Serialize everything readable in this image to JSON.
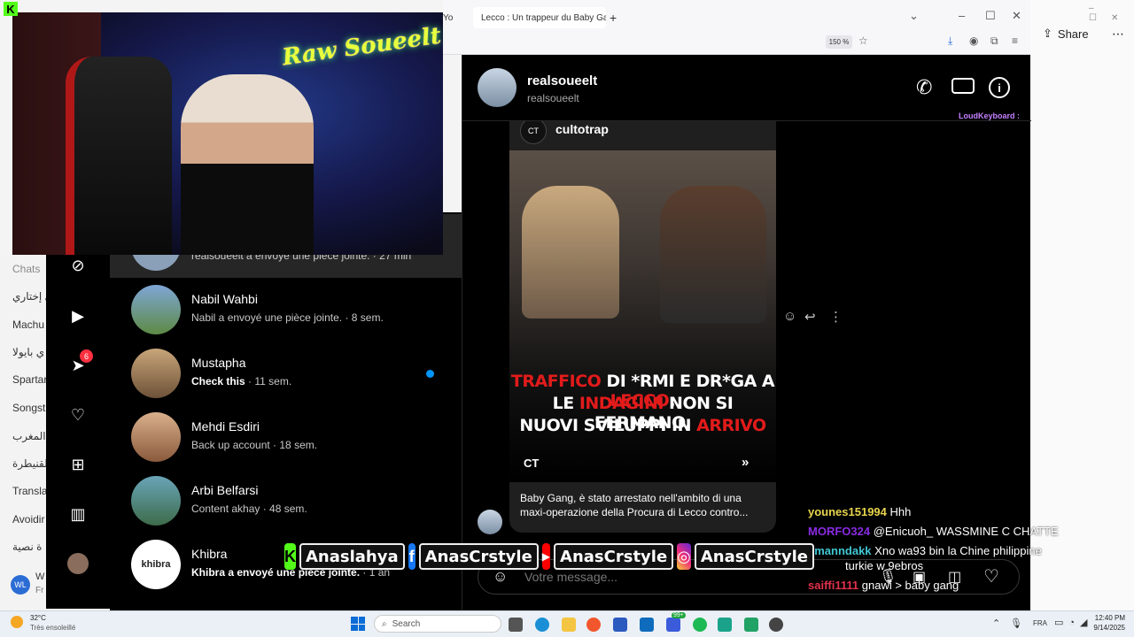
{
  "browser": {
    "tabs": [
      {
        "label": "Yo"
      },
      {
        "label": "Lecco : Un trappeur du Baby Ga"
      }
    ],
    "zoom": "150 %"
  },
  "outside": {
    "share": "Share"
  },
  "left_strip": {
    "header": "Chats",
    "items": [
      "يي إختاري",
      "Machu",
      "ي بايولا",
      "Spartar",
      "Songst",
      "المغرب",
      "لقنيطرة",
      "Translat",
      "Avoidir",
      "ة نصية"
    ],
    "avatar_initials": "WL",
    "extra": [
      "W",
      "Fr"
    ]
  },
  "instagram": {
    "rail_badges": {
      "notifications": "6"
    },
    "chats": [
      {
        "name": "",
        "preview": "realsoueelt a envoyé une pièce jointe. · 27 min"
      },
      {
        "name": "Nabil Wahbi",
        "preview": "Nabil a envoyé une pièce jointe. · 8 sem.",
        "bold": false
      },
      {
        "name": "Mustapha",
        "preview_bold": "Check this",
        "preview_rest": " · 11 sem."
      },
      {
        "name": "Mehdi Esdiri",
        "preview": "Back up account · 18 sem."
      },
      {
        "name": "Arbi Belfarsi",
        "preview": "Content akhay · 48 sem."
      },
      {
        "name": "Khibra",
        "preview_bold": "Khibra a envoyé une pièce jointe.",
        "preview_rest": " · 1 an",
        "avatar_text": "khibra"
      }
    ],
    "conversation": {
      "name": "realsoueelt",
      "username": "realsoueelt",
      "post_author": "cultotrap",
      "headline_line1_parts": [
        "TRAFFICO",
        " DI *RMI E DR*GA A ",
        "LECCO",
        ":"
      ],
      "headline_line2_parts": [
        "LE ",
        "INDAGINI",
        " NON SI FERMANO,"
      ],
      "headline_line3_parts": [
        "NUOVI SVILUPPI IN ",
        "ARRIVO"
      ],
      "post_caption": "Baby Gang, è stato arrestato nell'ambito di una maxi-operazione della Procura di Lecco contro...",
      "message_placeholder": "Votre message..."
    }
  },
  "overlay": {
    "loud_keyboard": "LoudKeyboard :",
    "chat": [
      {
        "user": "younes151994",
        "msg": "Hhh",
        "color": "#e8d44d"
      },
      {
        "user": "MORFO324",
        "msg": "@Enicuoh_ WASSMINE C CHATTE",
        "color": "#8a2be2"
      },
      {
        "user": "ymanndakk",
        "msg": "Xno wa93 bin la Chine   philippine",
        "color": "#41c6d3"
      },
      {
        "user": "",
        "msg": "turkie w 9ebros",
        "color": "#fff"
      },
      {
        "user": "saiffi1111",
        "msg": "gnawi > baby gang",
        "color": "#e0314b"
      }
    ],
    "banner": [
      {
        "kind": "kick",
        "label": "Anaslahya"
      },
      {
        "kind": "facebook",
        "label": "AnasCrstyle"
      },
      {
        "kind": "youtube",
        "label": "AnasCrstyle"
      },
      {
        "kind": "instagram",
        "label": "AnasCrstyle"
      }
    ],
    "stream_logo": "Raw Soueelt"
  },
  "taskbar": {
    "weather_temp": "32°C",
    "weather_desc": "Très ensoleillé",
    "search": "Search",
    "lang": "FRA",
    "time": "12:40 PM",
    "date": "9/14/2025",
    "badge": "99+"
  }
}
